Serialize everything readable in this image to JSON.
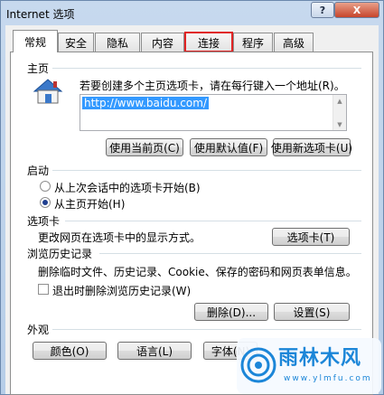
{
  "window": {
    "title": "Internet 选项",
    "help_label": "?",
    "close_label": "X"
  },
  "tabs": [
    {
      "label": "常规",
      "active": true
    },
    {
      "label": "安全"
    },
    {
      "label": "隐私"
    },
    {
      "label": "内容"
    },
    {
      "label": "连接",
      "highlighted": true
    },
    {
      "label": "程序"
    },
    {
      "label": "高级"
    }
  ],
  "home": {
    "heading": "主页",
    "description": "若要创建多个主页选项卡，请在每行键入一个地址(R)。",
    "url": "http://www.baidu.com/",
    "btn_current": "使用当前页(C)",
    "btn_default": "使用默认值(F)",
    "btn_newtab": "使用新选项卡(U)"
  },
  "startup": {
    "heading": "启动",
    "option_last": "从上次会话中的选项卡开始(B)",
    "option_home": "从主页开始(H)",
    "selected": "option_home"
  },
  "tabs_section": {
    "heading": "选项卡",
    "description": "更改网页在选项卡中的显示方式。",
    "button": "选项卡(T)"
  },
  "history": {
    "heading": "浏览历史记录",
    "description": "删除临时文件、历史记录、Cookie、保存的密码和网页表单信息。",
    "checkbox_label": "退出时删除浏览历史记录(W)",
    "checked": false,
    "btn_delete": "删除(D)...",
    "btn_settings": "设置(S)"
  },
  "appearance": {
    "heading": "外观",
    "btn_colors": "颜色(O)",
    "btn_language": "语言(L)",
    "btn_fonts": "字体(N)"
  },
  "watermark": {
    "text": "雨林木风",
    "url": "www.ylmfu.com"
  },
  "colors": {
    "selection": "#3399ff",
    "highlight_outline": "#e02424",
    "watermark": "#1c86d8"
  }
}
